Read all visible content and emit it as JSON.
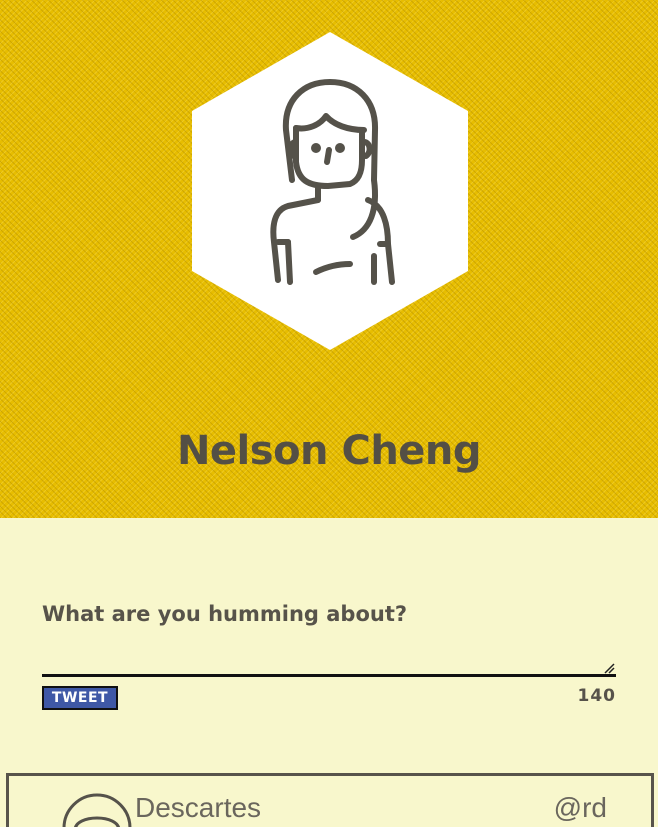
{
  "profile": {
    "name": "Nelson Cheng",
    "avatar_icon": "woman-avatar-icon"
  },
  "composer": {
    "label": "What are you humming about?",
    "textarea_value": "",
    "tweet_label": "TWEET",
    "char_count": "140"
  },
  "feed": {
    "items": [
      {
        "name": "Descartes",
        "handle": "@rd",
        "avatar_icon": "person-avatar-icon"
      }
    ]
  },
  "colors": {
    "header_bg": "#e7bd00",
    "page_bg": "#f8f7cc",
    "text": "#55524a",
    "tweet_button": "#3f58a6"
  }
}
